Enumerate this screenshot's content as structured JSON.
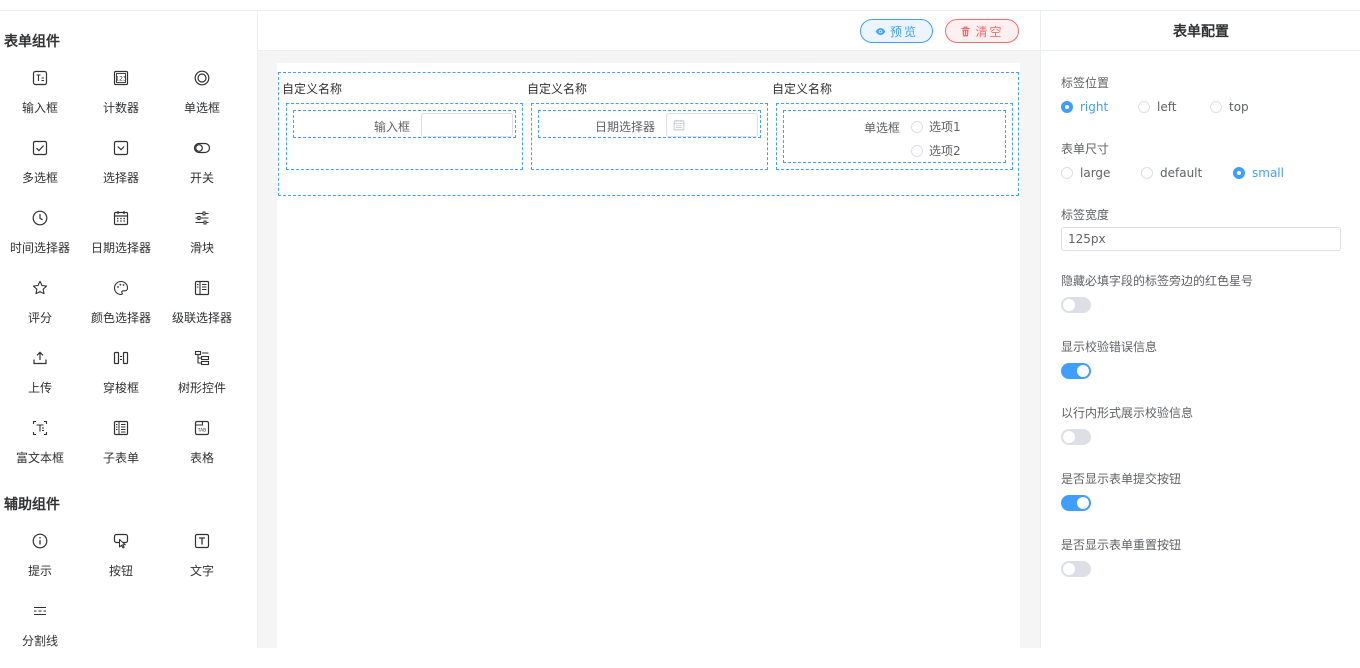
{
  "left": {
    "form_section_title": "表单组件",
    "form_components": [
      {
        "label": "输入框",
        "icon": "input-icon"
      },
      {
        "label": "计数器",
        "icon": "counter-icon"
      },
      {
        "label": "单选框",
        "icon": "radio-icon"
      },
      {
        "label": "多选框",
        "icon": "checkbox-icon"
      },
      {
        "label": "选择器",
        "icon": "select-icon"
      },
      {
        "label": "开关",
        "icon": "switch-icon"
      },
      {
        "label": "时间选择器",
        "icon": "clock-icon"
      },
      {
        "label": "日期选择器",
        "icon": "calendar-icon"
      },
      {
        "label": "滑块",
        "icon": "slider-icon"
      },
      {
        "label": "评分",
        "icon": "star-icon"
      },
      {
        "label": "颜色选择器",
        "icon": "palette-icon"
      },
      {
        "label": "级联选择器",
        "icon": "cascader-icon"
      },
      {
        "label": "上传",
        "icon": "upload-icon"
      },
      {
        "label": "穿梭框",
        "icon": "transfer-icon"
      },
      {
        "label": "树形控件",
        "icon": "tree-icon"
      },
      {
        "label": "富文本框",
        "icon": "richtext-icon"
      },
      {
        "label": "子表单",
        "icon": "subform-icon"
      },
      {
        "label": "表格",
        "icon": "table-tab-icon"
      }
    ],
    "aux_section_title": "辅助组件",
    "aux_components": [
      {
        "label": "提示",
        "icon": "info-icon"
      },
      {
        "label": "按钮",
        "icon": "button-click-icon"
      },
      {
        "label": "文字",
        "icon": "text-icon"
      },
      {
        "label": "分割线",
        "icon": "divider-icon"
      }
    ]
  },
  "toolbar": {
    "preview_label": "预览",
    "clear_label": "清空",
    "preview_icon": "eye-icon",
    "clear_icon": "trash-icon"
  },
  "canvas": {
    "columns": [
      {
        "title": "自定义名称",
        "item_label": "输入框"
      },
      {
        "title": "自定义名称",
        "item_label": "日期选择器"
      },
      {
        "title": "自定义名称",
        "item_label": "单选框",
        "options": [
          "选项1",
          "选项2"
        ]
      }
    ]
  },
  "config": {
    "title": "表单配置",
    "label_position": {
      "label": "标签位置",
      "options": [
        "right",
        "left",
        "top"
      ],
      "selected": "right"
    },
    "form_size": {
      "label": "表单尺寸",
      "options": [
        "large",
        "default",
        "small"
      ],
      "selected": "small"
    },
    "label_width": {
      "label": "标签宽度",
      "value": "125px"
    },
    "hide_required_asterisk": {
      "label": "隐藏必填字段的标签旁边的红色星号",
      "on": false
    },
    "show_validation_message": {
      "label": "显示校验错误信息",
      "on": true
    },
    "inline_validation_message": {
      "label": "以行内形式展示校验信息",
      "on": false
    },
    "show_submit_button": {
      "label": "是否显示表单提交按钮",
      "on": true
    },
    "show_reset_button": {
      "label": "是否显示表单重置按钮",
      "on": false
    }
  },
  "colors": {
    "accent": "#409eff",
    "danger": "#f56c6c",
    "border": "#dcdfe6"
  }
}
